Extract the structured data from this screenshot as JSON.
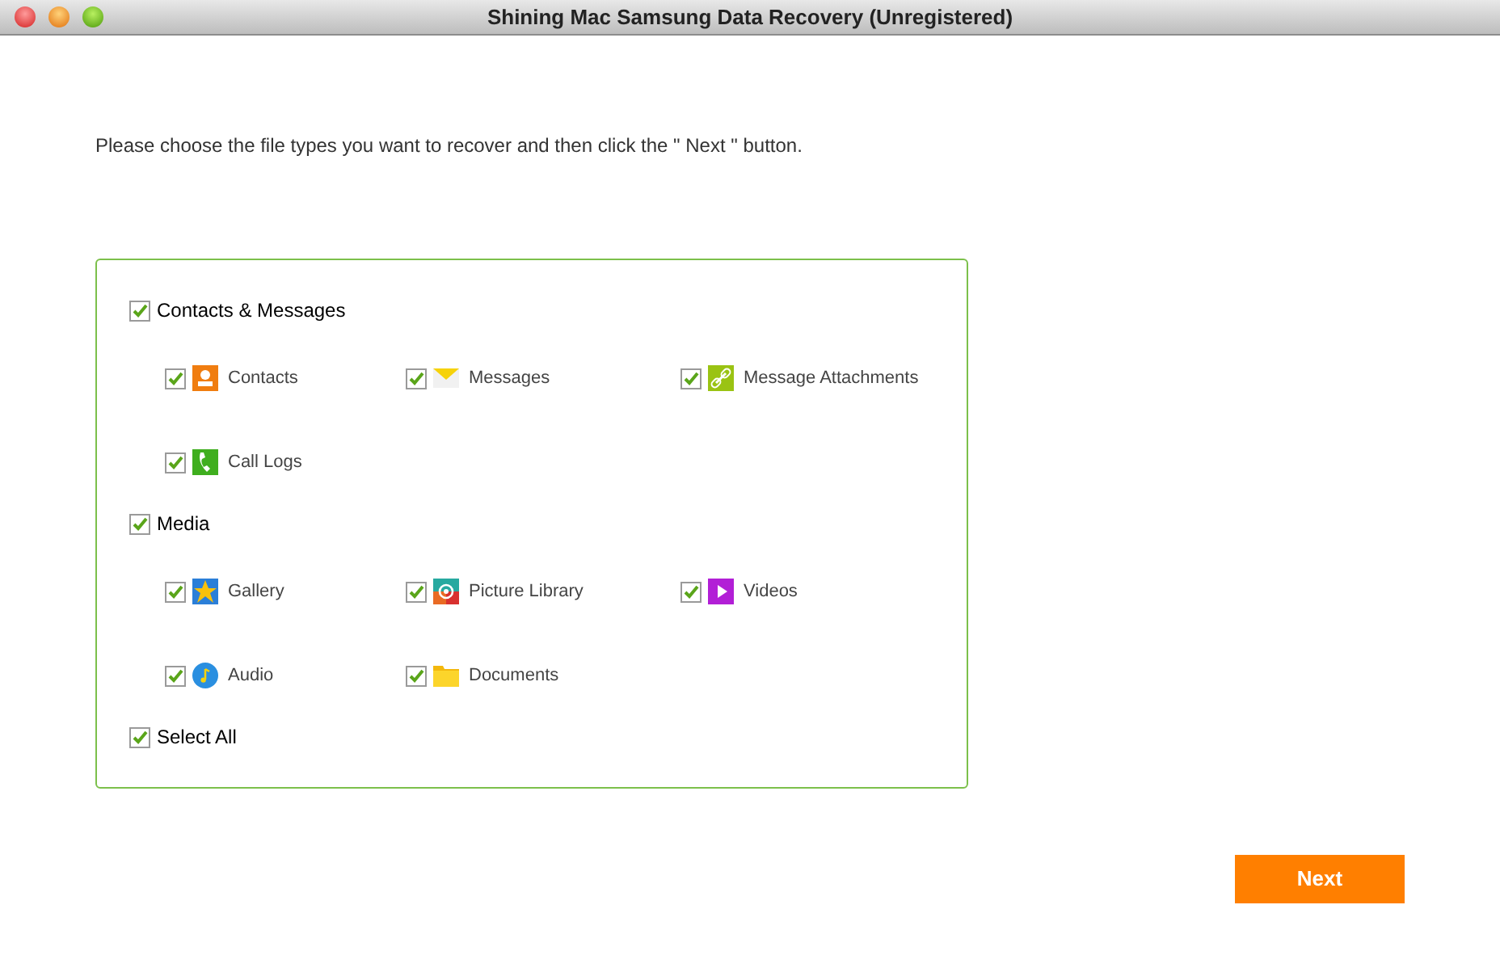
{
  "window": {
    "title": "Shining Mac Samsung Data Recovery (Unregistered)"
  },
  "instruction": "Please choose the file types you want to recover and then click the \" Next \" button.",
  "groups": [
    {
      "label": "Contacts & Messages",
      "checked": true,
      "items": [
        {
          "label": "Contacts",
          "checked": true
        },
        {
          "label": "Messages",
          "checked": true
        },
        {
          "label": "Message Attachments",
          "checked": true
        },
        {
          "label": "Call Logs",
          "checked": true
        }
      ]
    },
    {
      "label": "Media",
      "checked": true,
      "items": [
        {
          "label": "Gallery",
          "checked": true
        },
        {
          "label": "Picture Library",
          "checked": true
        },
        {
          "label": "Videos",
          "checked": true
        },
        {
          "label": "Audio",
          "checked": true
        },
        {
          "label": "Documents",
          "checked": true
        }
      ]
    }
  ],
  "select_all": {
    "label": "Select All",
    "checked": true
  },
  "next_button": "Next"
}
